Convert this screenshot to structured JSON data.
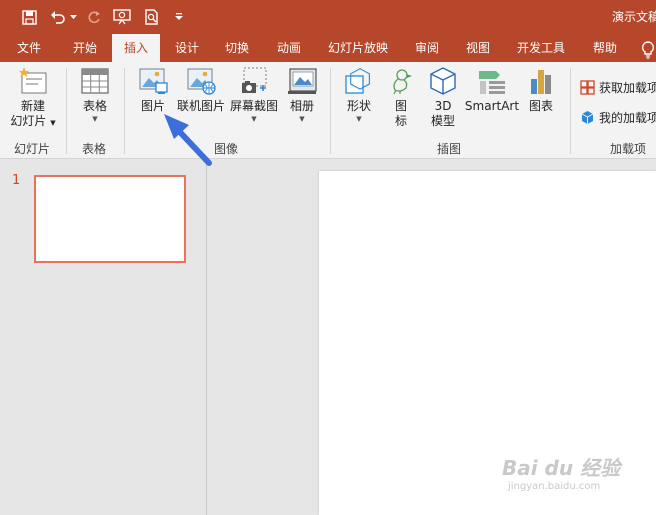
{
  "window": {
    "title": "演示文稿"
  },
  "quick_access": {
    "icons": [
      "save-icon",
      "undo-icon",
      "redo-icon",
      "slideshow-from-start-icon",
      "print-preview-icon",
      "customize-toolbar-icon"
    ]
  },
  "tabs": [
    {
      "label": "文件"
    },
    {
      "label": "开始"
    },
    {
      "label": "插入",
      "active": true
    },
    {
      "label": "设计"
    },
    {
      "label": "切换"
    },
    {
      "label": "动画"
    },
    {
      "label": "幻灯片放映"
    },
    {
      "label": "审阅"
    },
    {
      "label": "视图"
    },
    {
      "label": "开发工具"
    },
    {
      "label": "帮助"
    }
  ],
  "ribbon": {
    "new_slide": {
      "line1": "新建",
      "line2": "幻灯片"
    },
    "table": {
      "label": "表格"
    },
    "picture": {
      "label": "图片"
    },
    "online_picture": {
      "label": "联机图片"
    },
    "screenshot": {
      "label": "屏幕截图"
    },
    "album": {
      "label": "相册"
    },
    "shapes": {
      "label": "形状"
    },
    "icons": {
      "line1": "图",
      "line2": "标"
    },
    "model3d": {
      "line1": "3D",
      "line2": "模型"
    },
    "smartart": {
      "label": "SmartArt"
    },
    "chart": {
      "label": "图表"
    },
    "get_addins": {
      "label": "获取加载项"
    },
    "my_addins": {
      "label": "我的加载项"
    },
    "groups": {
      "slides": "幻灯片",
      "tables": "表格",
      "images": "图像",
      "illustrations": "插图",
      "addins": "加载项"
    }
  },
  "thumbnails": [
    {
      "number": "1"
    }
  ],
  "watermark": {
    "logo": "Bai du 经验",
    "url": "jingyan.baidu.com"
  },
  "colors": {
    "accent": "#b7472a",
    "thumb_border": "#e8735a",
    "arrow": "#3c6fdc"
  }
}
